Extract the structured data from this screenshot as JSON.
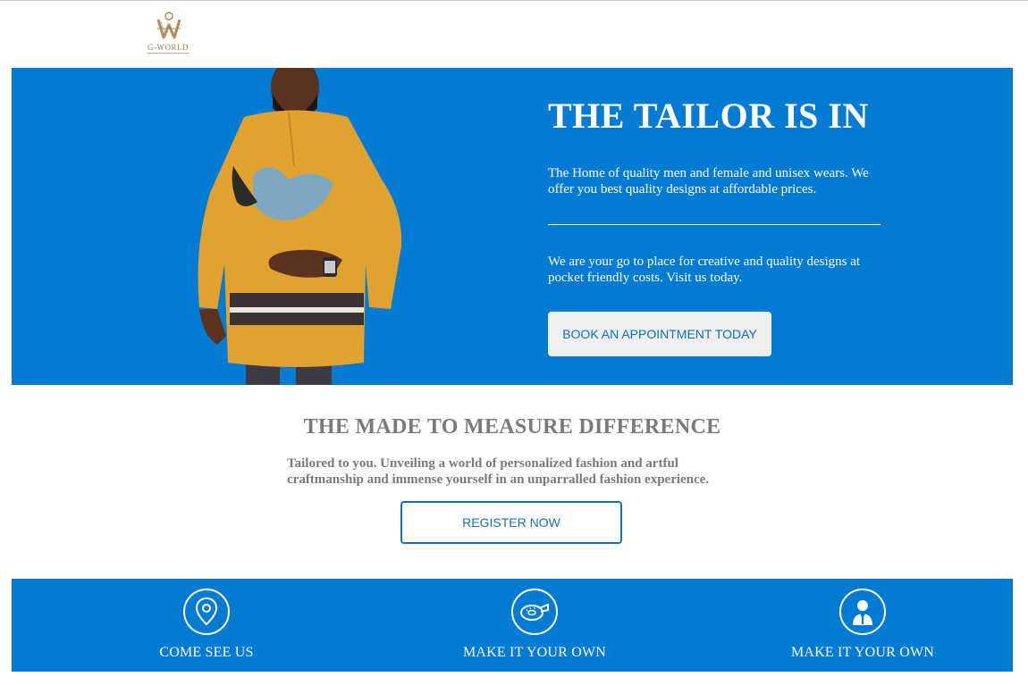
{
  "logo": {
    "text": "G-WORLD",
    "colors": {
      "gold": "#b08a5a"
    }
  },
  "hero": {
    "title": "THE TAILOR IS IN",
    "text1": "The Home of quality men and female and unisex wears. We offer you best quality designs at affordable prices.",
    "text2": "We are your go to place for creative and quality designs at pocket friendly costs. Visit us today.",
    "button": "BOOK AN APPOINTMENT TODAY",
    "background_color": "#037bd3"
  },
  "section": {
    "title": "THE MADE TO MEASURE DIFFERENCE",
    "text": "Tailored to you. Unveiling a world of personalized fashion and artful craftmanship and immense yourself in an unparralled fashion experience.",
    "button": "REGISTER NOW"
  },
  "features": [
    {
      "label": "COME SEE US",
      "icon": "location-pin-icon"
    },
    {
      "label": "MAKE IT YOUR OWN",
      "icon": "measuring-tape-icon"
    },
    {
      "label": "MAKE IT YOUR OWN",
      "icon": "tailor-person-icon"
    }
  ]
}
